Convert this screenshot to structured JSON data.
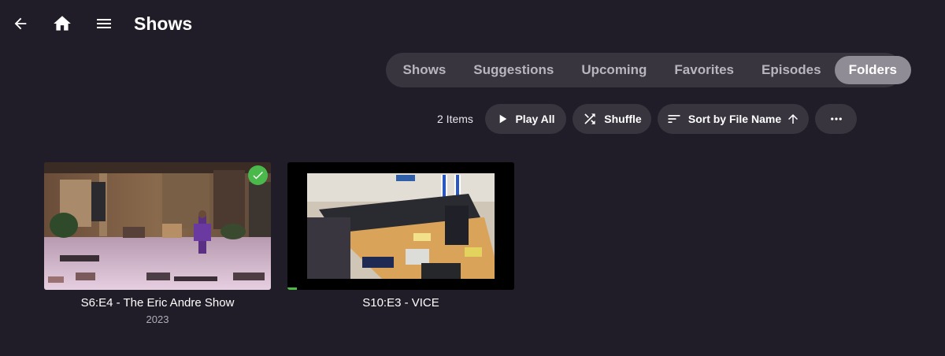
{
  "header": {
    "title": "Shows",
    "back_icon": "arrow-left-icon",
    "home_icon": "home-icon",
    "menu_icon": "hamburger-menu-icon"
  },
  "tabs": [
    {
      "label": "Shows",
      "active": false
    },
    {
      "label": "Suggestions",
      "active": false
    },
    {
      "label": "Upcoming",
      "active": false
    },
    {
      "label": "Favorites",
      "active": false
    },
    {
      "label": "Episodes",
      "active": false
    },
    {
      "label": "Folders",
      "active": true
    }
  ],
  "toolbar": {
    "item_count": "2 Items",
    "play_all_label": "Play All",
    "shuffle_label": "Shuffle",
    "sort_label": "Sort by File Name",
    "sort_direction": "ascending"
  },
  "items": [
    {
      "title": "S6:E4 - The Eric Andre Show",
      "subtitle": "2023",
      "played": true
    },
    {
      "title": "S10:E3 - VICE",
      "subtitle": "",
      "played": false,
      "progress_fraction": 0.04
    }
  ],
  "colors": {
    "background": "#201d28",
    "button_bg": "#38353f",
    "active_tab_bg": "#8f8c96",
    "played_badge": "#4ab84a",
    "progress": "#4cbb45"
  }
}
